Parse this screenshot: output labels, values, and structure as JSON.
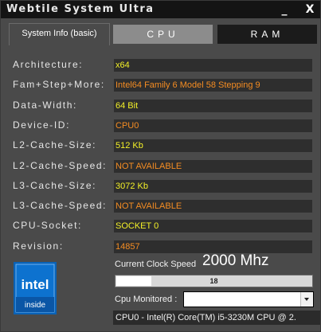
{
  "window": {
    "title": "Webtile System Ultra",
    "minimize_label": "_",
    "close_label": "X"
  },
  "tabs": [
    {
      "label": "System Info (basic)",
      "active": true
    },
    {
      "label": "CPU",
      "active": false
    },
    {
      "label": "RAM",
      "active": false
    }
  ],
  "properties": [
    {
      "label": "Architecture:",
      "value": "x64",
      "color": "#f3f028"
    },
    {
      "label": "Fam+Step+More:",
      "value": "Intel64 Family 6 Model 58 Stepping 9",
      "color": "#f48c22"
    },
    {
      "label": "Data-Width:",
      "value": "64 Bit",
      "color": "#f3f028"
    },
    {
      "label": "Device-ID:",
      "value": "CPU0",
      "color": "#f48c22"
    },
    {
      "label": "L2-Cache-Size:",
      "value": "512 Kb",
      "color": "#f3f028"
    },
    {
      "label": "L2-Cache-Speed:",
      "value": "NOT AVAILABLE",
      "color": "#f48c22"
    },
    {
      "label": "L3-Cache-Size:",
      "value": "3072 Kb",
      "color": "#f3f028"
    },
    {
      "label": "L3-Cache-Speed:",
      "value": "NOT AVAILABLE",
      "color": "#f48c22"
    },
    {
      "label": "CPU-Socket:",
      "value": "SOCKET 0",
      "color": "#f3f028"
    },
    {
      "label": "Revision:",
      "value": "14857",
      "color": "#f48c22"
    }
  ],
  "logo": {
    "brand": "intel",
    "sub": "inside",
    "icon": "intel-inside-logo"
  },
  "clock": {
    "label": "Current Clock Speed",
    "value": "2000 Mhz"
  },
  "cpu_usage": {
    "percent": 18,
    "text": "18"
  },
  "monitor": {
    "label": "Cpu Monitored :",
    "selected": ""
  },
  "status_bar": {
    "text": "CPU0 - Intel(R) Core(TM) i5-3230M CPU @ 2."
  }
}
